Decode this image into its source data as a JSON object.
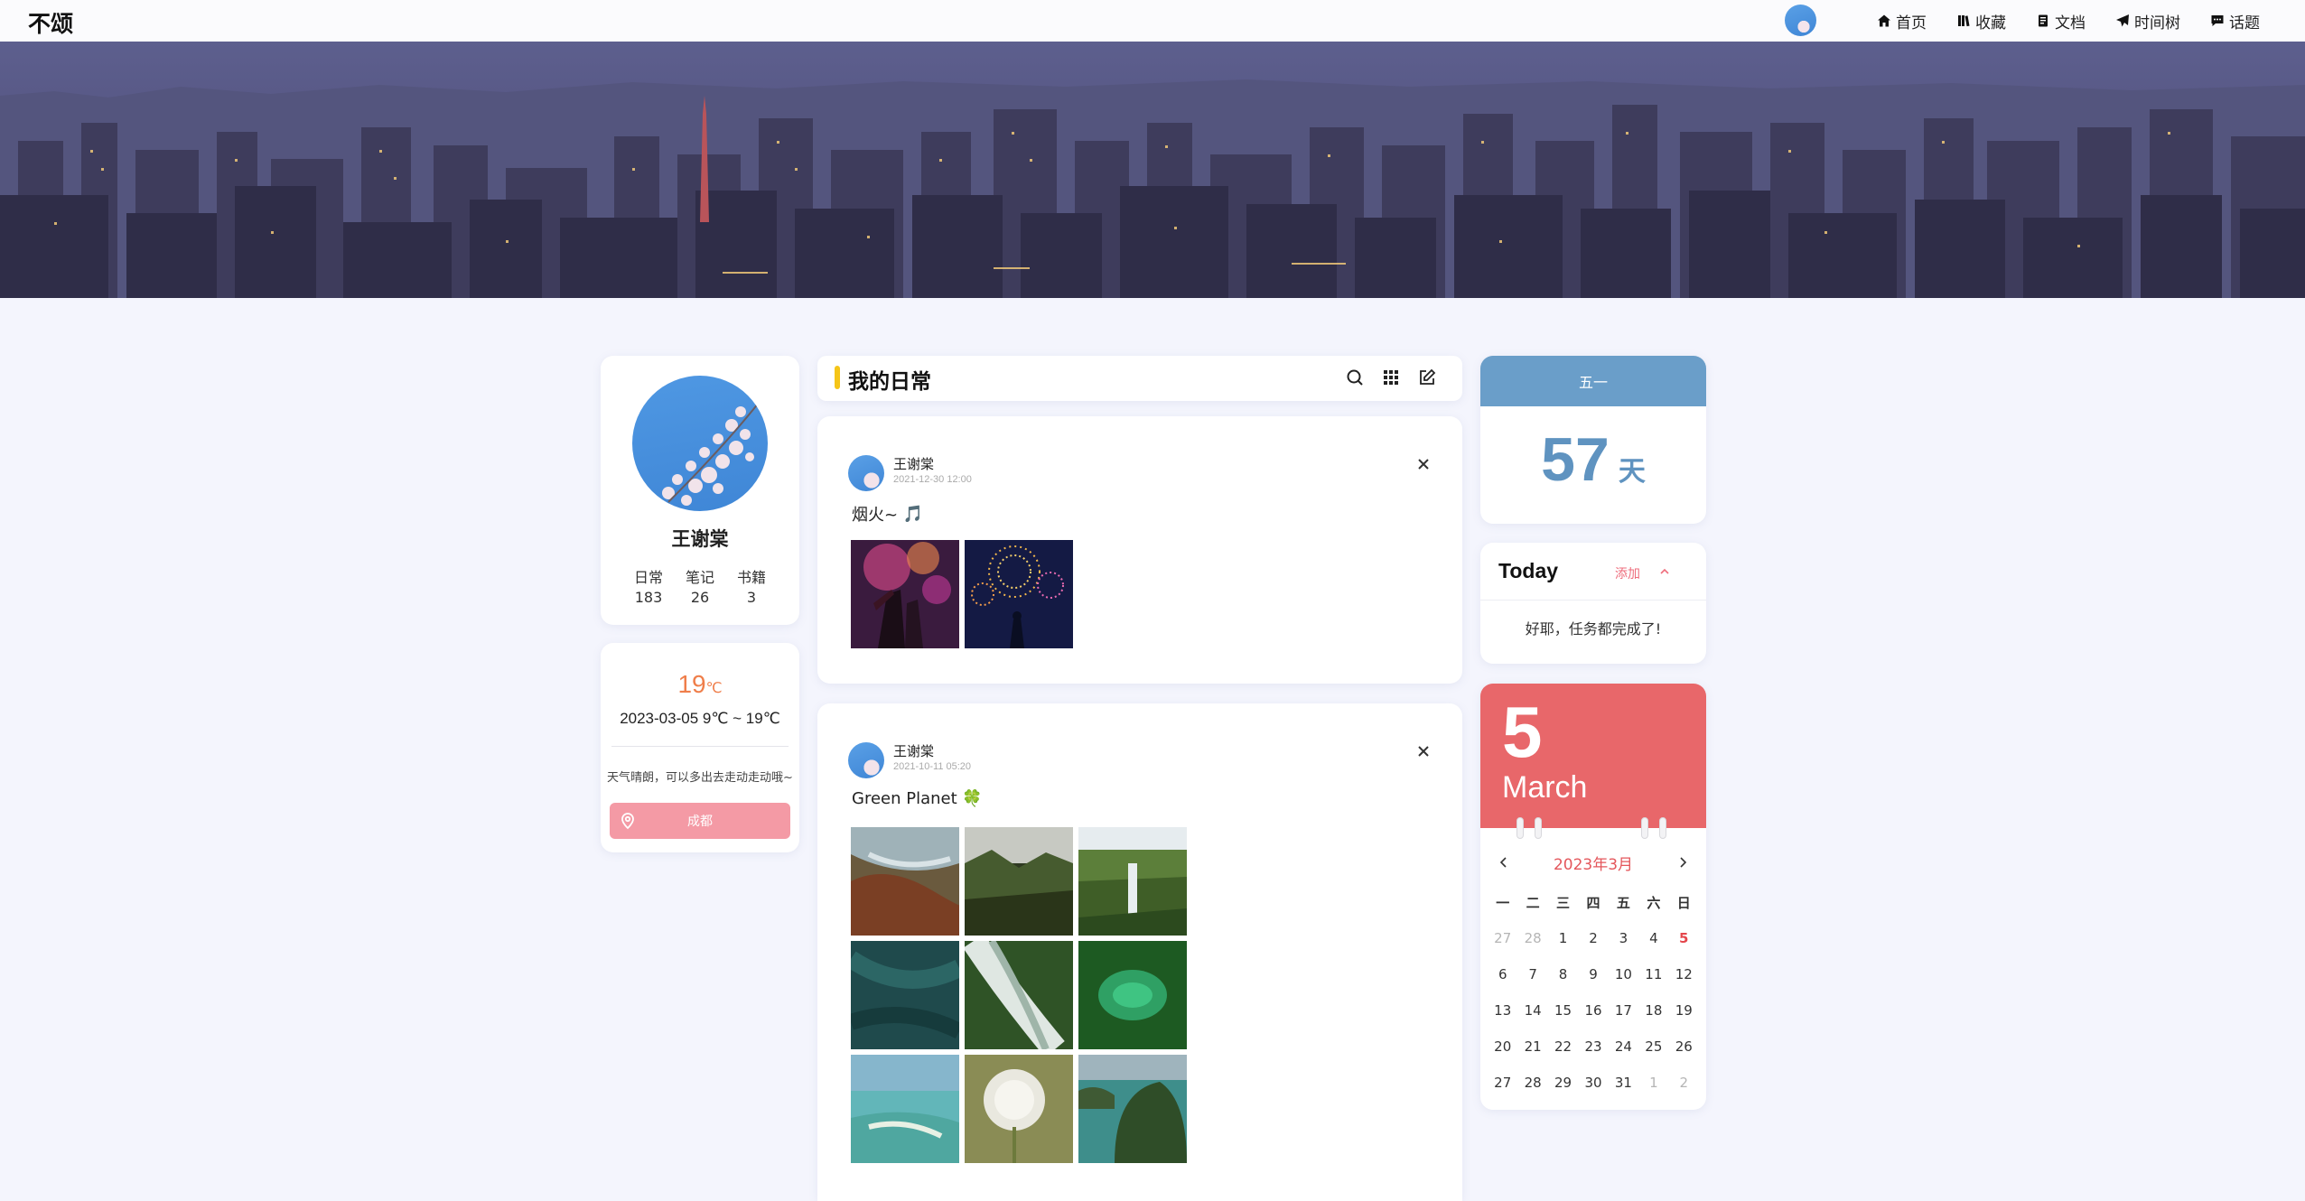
{
  "nav": {
    "brand": "不颂",
    "items": [
      {
        "label": "首页",
        "icon": "home-icon"
      },
      {
        "label": "收藏",
        "icon": "bookmark-icon"
      },
      {
        "label": "文档",
        "icon": "document-icon"
      },
      {
        "label": "时间树",
        "icon": "send-icon"
      },
      {
        "label": "话题",
        "icon": "chat-icon"
      }
    ]
  },
  "profile": {
    "name": "王谢棠",
    "stats": [
      {
        "label": "日常",
        "value": "183"
      },
      {
        "label": "笔记",
        "value": "26"
      },
      {
        "label": "书籍",
        "value": "3"
      }
    ]
  },
  "weather": {
    "temp": "19",
    "unit": "℃",
    "date_range": "2023-03-05 9℃ ~ 19℃",
    "tip": "天气晴朗，可以多出去走动走动哦~",
    "city": "成都"
  },
  "feed": {
    "title": "我的日常",
    "posts": [
      {
        "author": "王谢棠",
        "time": "2021-12-30 12:00",
        "text": "烟火~",
        "emoji": "🎵"
      },
      {
        "author": "王谢棠",
        "time": "2021-10-11 05:20",
        "text": "Green Planet",
        "emoji": "🍀"
      }
    ]
  },
  "countdown": {
    "event": "五一",
    "days": "57",
    "unit": "天"
  },
  "today": {
    "title": "Today",
    "add_label": "添加",
    "message": "好耶，任务都完成了!"
  },
  "calendar": {
    "day": "5",
    "month": "March",
    "title": "2023年3月",
    "weekdays": [
      "一",
      "二",
      "三",
      "四",
      "五",
      "六",
      "日"
    ],
    "days": [
      {
        "d": "27",
        "muted": true
      },
      {
        "d": "28",
        "muted": true
      },
      {
        "d": "1"
      },
      {
        "d": "2"
      },
      {
        "d": "3"
      },
      {
        "d": "4"
      },
      {
        "d": "5",
        "today": true
      },
      {
        "d": "6"
      },
      {
        "d": "7"
      },
      {
        "d": "8"
      },
      {
        "d": "9"
      },
      {
        "d": "10"
      },
      {
        "d": "11"
      },
      {
        "d": "12"
      },
      {
        "d": "13"
      },
      {
        "d": "14"
      },
      {
        "d": "15"
      },
      {
        "d": "16"
      },
      {
        "d": "17"
      },
      {
        "d": "18"
      },
      {
        "d": "19"
      },
      {
        "d": "20"
      },
      {
        "d": "21"
      },
      {
        "d": "22"
      },
      {
        "d": "23"
      },
      {
        "d": "24"
      },
      {
        "d": "25"
      },
      {
        "d": "26"
      },
      {
        "d": "27"
      },
      {
        "d": "28"
      },
      {
        "d": "29"
      },
      {
        "d": "30"
      },
      {
        "d": "31"
      },
      {
        "d": "1",
        "muted": true
      },
      {
        "d": "2",
        "muted": true
      }
    ]
  }
}
